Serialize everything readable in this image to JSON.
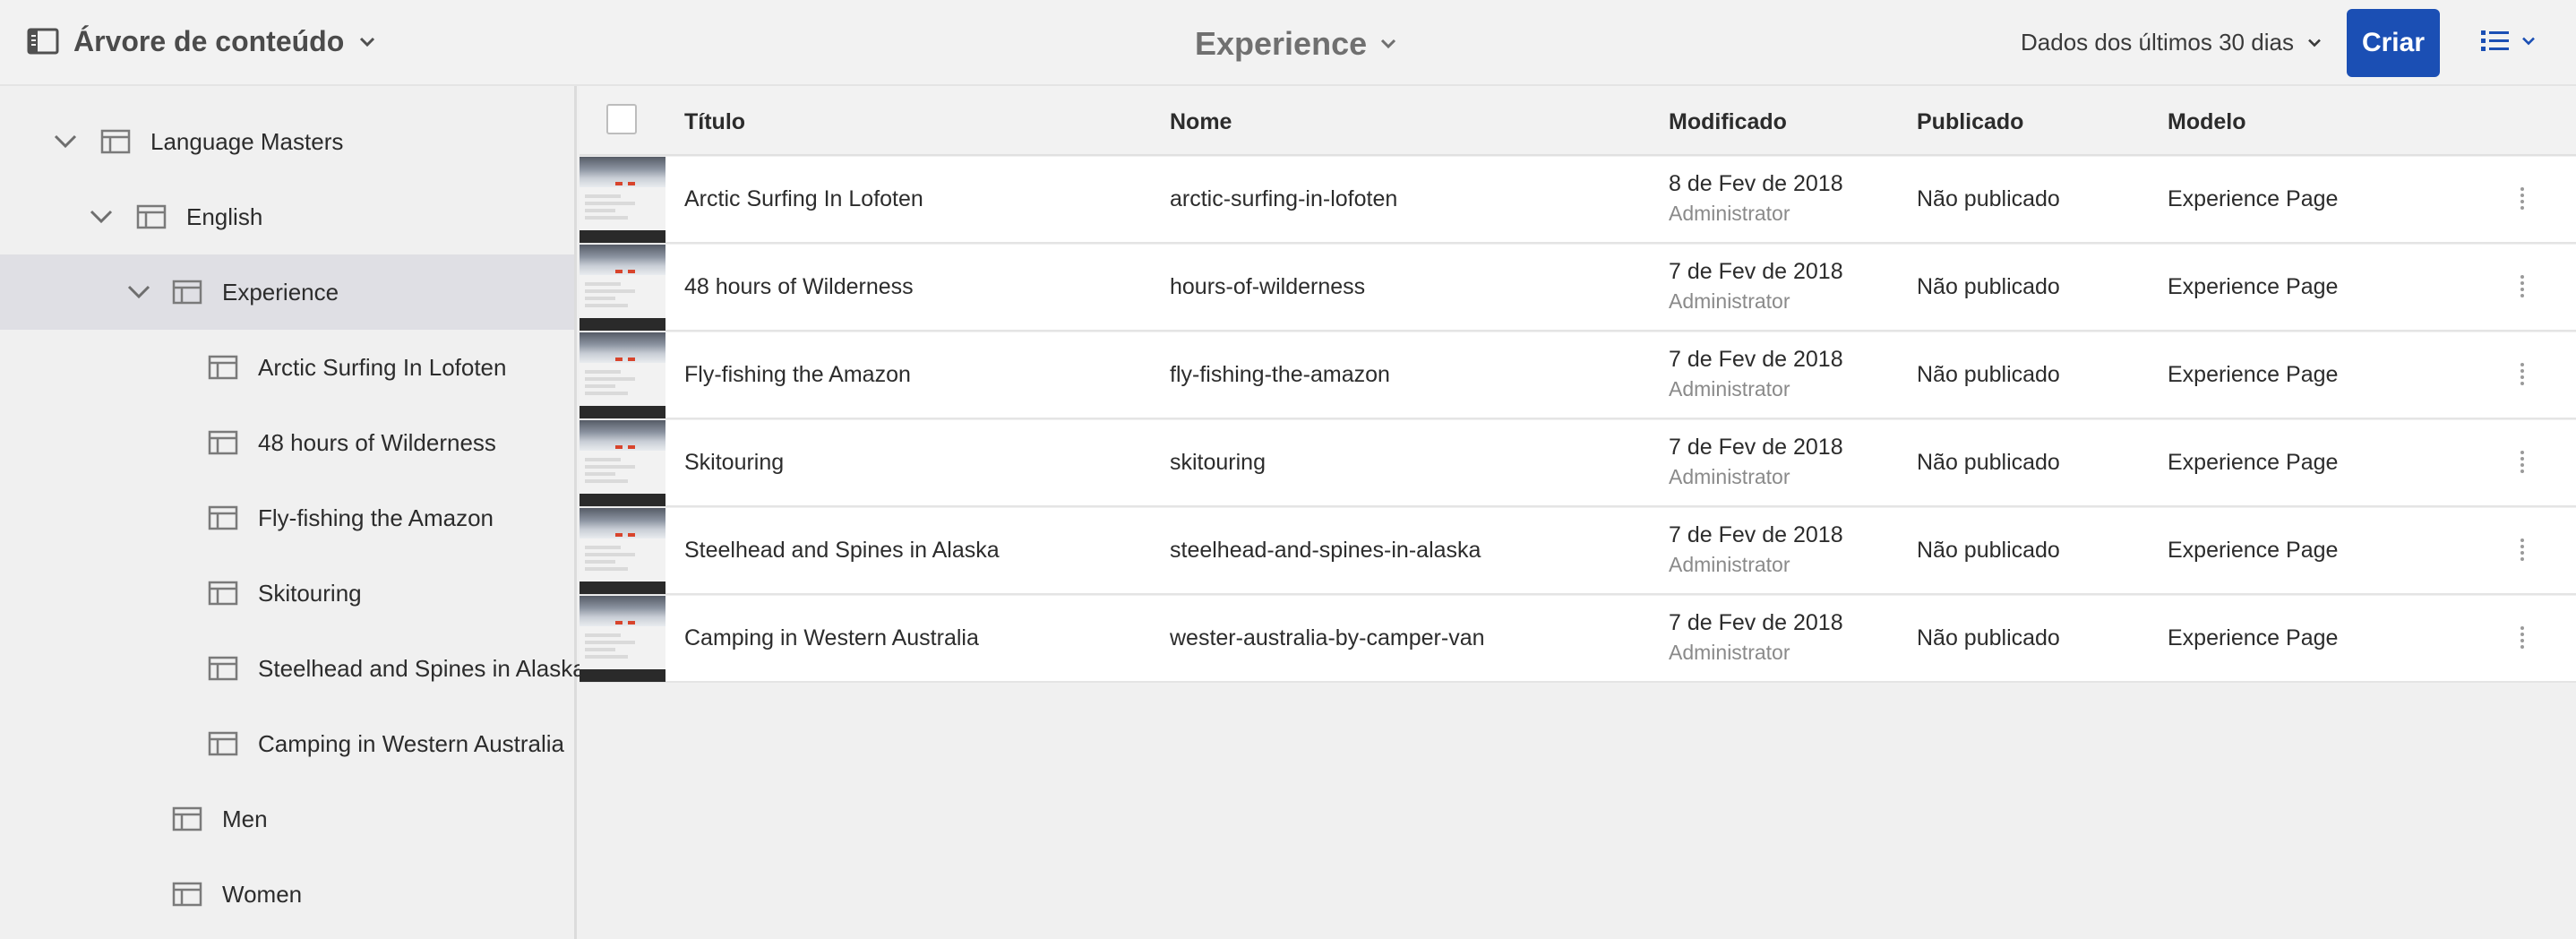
{
  "topbar": {
    "rail_title": "Árvore de conteúdo",
    "title": "Experience",
    "range_label": "Dados dos últimos 30 dias",
    "create_label": "Criar"
  },
  "tree": [
    {
      "label": "Language Masters",
      "icon": "page-icon",
      "expanded": true
    },
    {
      "label": "English",
      "icon": "page-icon",
      "expanded": true
    },
    {
      "label": "Experience",
      "icon": "page-icon",
      "expanded": true,
      "selected": true
    },
    {
      "label": "Arctic Surfing In Lofoten",
      "icon": "page-icon"
    },
    {
      "label": "48 hours of Wilderness",
      "icon": "page-icon"
    },
    {
      "label": "Fly-fishing the Amazon",
      "icon": "page-icon"
    },
    {
      "label": "Skitouring",
      "icon": "page-icon"
    },
    {
      "label": "Steelhead and Spines in Alaska",
      "icon": "page-icon"
    },
    {
      "label": "Camping in Western Australia",
      "icon": "page-icon"
    },
    {
      "label": "Men",
      "icon": "page-icon"
    },
    {
      "label": "Women",
      "icon": "page-icon"
    }
  ],
  "table": {
    "headers": {
      "title": "Título",
      "name": "Nome",
      "modified": "Modificado",
      "published": "Publicado",
      "template": "Modelo"
    },
    "rows": [
      {
        "title": "Arctic Surfing In Lofoten",
        "name": "arctic-surfing-in-lofoten",
        "modified_date": "8 de Fev de 2018",
        "modified_by": "Administrator",
        "published": "Não publicado",
        "template": "Experience Page"
      },
      {
        "title": "48 hours of Wilderness",
        "name": "hours-of-wilderness",
        "modified_date": "7 de Fev de 2018",
        "modified_by": "Administrator",
        "published": "Não publicado",
        "template": "Experience Page"
      },
      {
        "title": "Fly-fishing the Amazon",
        "name": "fly-fishing-the-amazon",
        "modified_date": "7 de Fev de 2018",
        "modified_by": "Administrator",
        "published": "Não publicado",
        "template": "Experience Page"
      },
      {
        "title": "Skitouring",
        "name": "skitouring",
        "modified_date": "7 de Fev de 2018",
        "modified_by": "Administrator",
        "published": "Não publicado",
        "template": "Experience Page"
      },
      {
        "title": "Steelhead and Spines in Alaska",
        "name": "steelhead-and-spines-in-alaska",
        "modified_date": "7 de Fev de 2018",
        "modified_by": "Administrator",
        "published": "Não publicado",
        "template": "Experience Page"
      },
      {
        "title": "Camping in Western Australia",
        "name": "wester-australia-by-camper-van",
        "modified_date": "7 de Fev de 2018",
        "modified_by": "Administrator",
        "published": "Não publicado",
        "template": "Experience Page"
      }
    ]
  },
  "colors": {
    "accent": "#1b4fb4",
    "selected_row": "#dfdfe4",
    "background": "#f0f0f0"
  }
}
